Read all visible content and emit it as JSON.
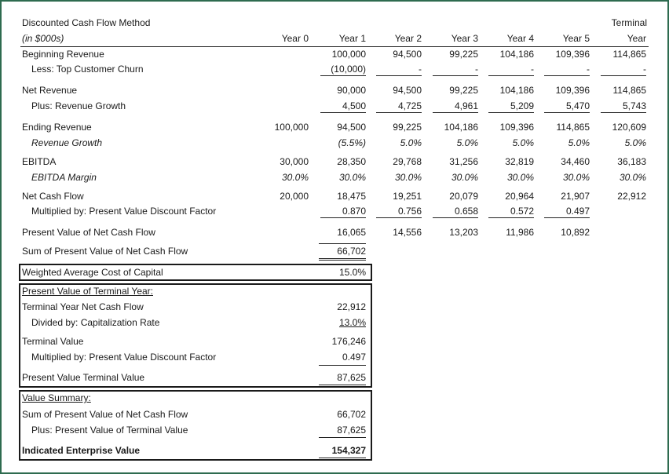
{
  "header": {
    "title": "Discounted Cash Flow Method",
    "units": "(in $000s)",
    "years": [
      "Year 0",
      "Year 1",
      "Year 2",
      "Year 3",
      "Year 4",
      "Year 5"
    ],
    "terminal_top": "Terminal",
    "terminal_bottom": "Year"
  },
  "rows": {
    "beginning_revenue": {
      "label": "Beginning Revenue",
      "values": [
        "",
        "100,000",
        "94,500",
        "99,225",
        "104,186",
        "109,396",
        "114,865"
      ]
    },
    "churn": {
      "label": "Less:  Top Customer Churn",
      "values": [
        "",
        "(10,000)",
        "-",
        "-",
        "-",
        "-",
        "-"
      ]
    },
    "net_revenue": {
      "label": "Net Revenue",
      "values": [
        "",
        "90,000",
        "94,500",
        "99,225",
        "104,186",
        "109,396",
        "114,865"
      ]
    },
    "revenue_growth_add": {
      "label": "Plus:  Revenue Growth",
      "values": [
        "",
        "4,500",
        "4,725",
        "4,961",
        "5,209",
        "5,470",
        "5,743"
      ]
    },
    "ending_revenue": {
      "label": "Ending Revenue",
      "values": [
        "100,000",
        "94,500",
        "99,225",
        "104,186",
        "109,396",
        "114,865",
        "120,609"
      ]
    },
    "revenue_growth_pct": {
      "label": "Revenue Growth",
      "values": [
        "",
        "(5.5%)",
        "5.0%",
        "5.0%",
        "5.0%",
        "5.0%",
        "5.0%"
      ]
    },
    "ebitda": {
      "label": "EBITDA",
      "values": [
        "30,000",
        "28,350",
        "29,768",
        "31,256",
        "32,819",
        "34,460",
        "36,183"
      ]
    },
    "ebitda_margin": {
      "label": "EBITDA Margin",
      "values": [
        "30.0%",
        "30.0%",
        "30.0%",
        "30.0%",
        "30.0%",
        "30.0%",
        "30.0%"
      ]
    },
    "net_cash_flow": {
      "label": "Net Cash Flow",
      "values": [
        "20,000",
        "18,475",
        "19,251",
        "20,079",
        "20,964",
        "21,907",
        "22,912"
      ]
    },
    "pv_factor": {
      "label": "Multiplied by:  Present Value Discount Factor",
      "values": [
        "",
        "0.870",
        "0.756",
        "0.658",
        "0.572",
        "0.497",
        ""
      ]
    },
    "pv_ncf": {
      "label": "Present Value of Net Cash Flow",
      "values": [
        "",
        "16,065",
        "14,556",
        "13,203",
        "11,986",
        "10,892",
        ""
      ]
    },
    "sum_pv_ncf": {
      "label": "Sum of Present Value of Net Cash Flow",
      "value": "66,702"
    }
  },
  "wacc": {
    "label": "Weighted Average Cost of Capital",
    "value": "15.0%"
  },
  "terminal": {
    "heading": "Present Value of Terminal Year:",
    "ncf_label": "Terminal Year Net Cash Flow",
    "ncf_value": "22,912",
    "cap_label": "Divided by:  Capitalization Rate",
    "cap_value": "13.0%",
    "tv_label": "Terminal Value",
    "tv_value": "176,246",
    "factor_label": "Multiplied by:  Present Value Discount Factor",
    "factor_value": "0.497",
    "pv_label": "Present Value Terminal Value",
    "pv_value": "87,625"
  },
  "summary": {
    "heading": "Value Summary:",
    "sum_label": "Sum of Present Value of Net Cash Flow",
    "sum_value": "66,702",
    "plus_label": "Plus:  Present Value of Terminal Value",
    "plus_value": "87,625",
    "ev_label": "Indicated Enterprise Value",
    "ev_value": "154,327"
  },
  "colors": {
    "frame": "#2e6b4f"
  }
}
